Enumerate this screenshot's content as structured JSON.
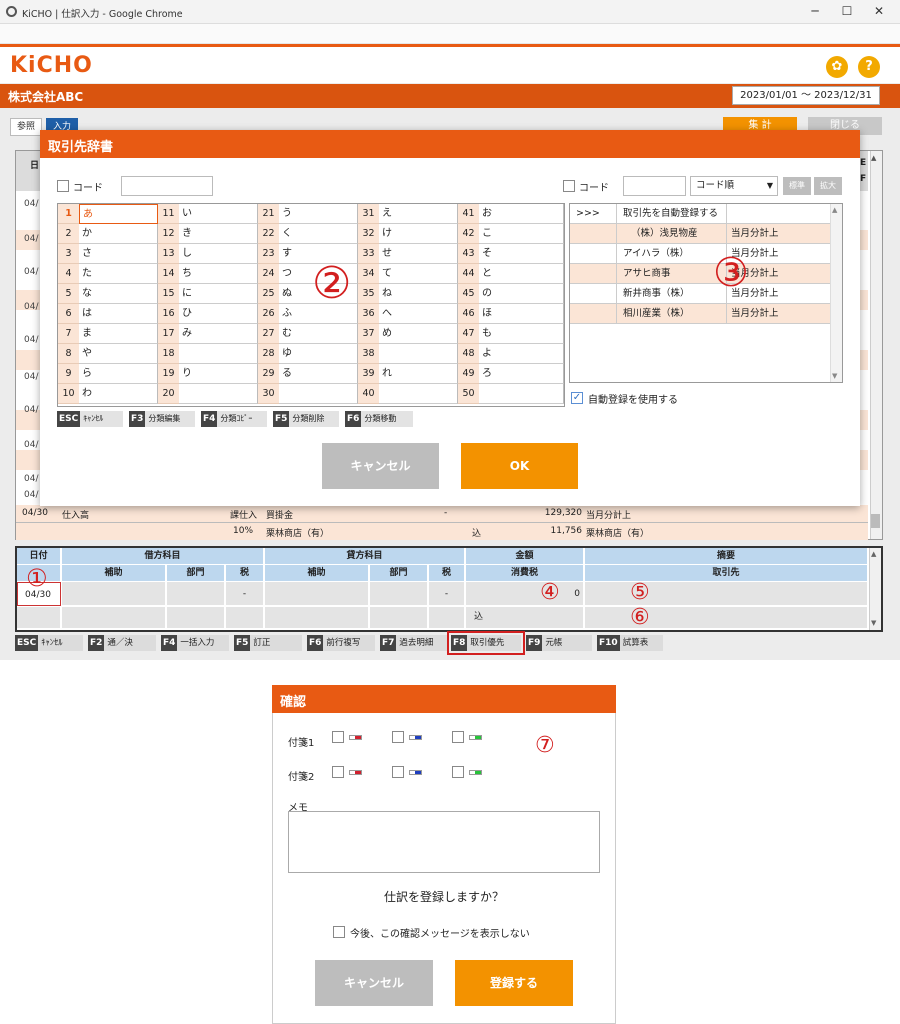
{
  "window": {
    "title": "KiCHO | 仕訳入力 - Google Chrome",
    "icon": "chrome-icon"
  },
  "app": {
    "logo": "KiCHO",
    "company": "株式会社ABC",
    "period": "2023/01/01 ～ 2023/12/31",
    "tabs": [
      "参照",
      "入力"
    ],
    "buttons": {
      "aggregate": "集 計",
      "close": "閉じる"
    },
    "icons": [
      "gear-icon",
      "help-icon"
    ]
  },
  "background_rows": [
    {
      "date": "04/"
    },
    {
      "date": "04/"
    },
    {
      "date": "04/"
    },
    {
      "date": "04/"
    },
    {
      "date": "04/"
    },
    {
      "date": "04/"
    },
    {
      "date": "04/"
    },
    {
      "date": "04/"
    },
    {
      "date": "04/"
    },
    {
      "date": "04/"
    }
  ],
  "grid_header": {
    "col1": "日",
    "col_e": "E",
    "col_f": "F"
  },
  "visible_entry": {
    "date": "04/30",
    "debit": "仕入高",
    "tax_cat": "課仕入",
    "credit": "買掛金",
    "dash": "-",
    "amount": "129,320",
    "summary": "当月分計上",
    "rate": "10%",
    "debit_partner": "栗林商店（有）",
    "incl": "込",
    "tax": "11,756",
    "partner": "栗林商店（有）"
  },
  "dialog": {
    "title": "取引先辞書",
    "code_label_left": "コード",
    "code_label_right": "コード",
    "sort_select": "コード順",
    "btn_standard": "標準",
    "btn_expand": "拡大",
    "kana_columns": [
      [
        [
          "1",
          "あ"
        ],
        [
          "2",
          "か"
        ],
        [
          "3",
          "さ"
        ],
        [
          "4",
          "た"
        ],
        [
          "5",
          "な"
        ],
        [
          "6",
          "は"
        ],
        [
          "7",
          "ま"
        ],
        [
          "8",
          "や"
        ],
        [
          "9",
          "ら"
        ],
        [
          "10",
          "わ"
        ]
      ],
      [
        [
          "11",
          "い"
        ],
        [
          "12",
          "き"
        ],
        [
          "13",
          "し"
        ],
        [
          "14",
          "ち"
        ],
        [
          "15",
          "に"
        ],
        [
          "16",
          "ひ"
        ],
        [
          "17",
          "み"
        ],
        [
          "18",
          ""
        ],
        [
          "19",
          "り"
        ],
        [
          "20",
          ""
        ]
      ],
      [
        [
          "21",
          "う"
        ],
        [
          "22",
          "く"
        ],
        [
          "23",
          "す"
        ],
        [
          "24",
          "つ"
        ],
        [
          "25",
          "ぬ"
        ],
        [
          "26",
          "ふ"
        ],
        [
          "27",
          "む"
        ],
        [
          "28",
          "ゆ"
        ],
        [
          "29",
          "る"
        ],
        [
          "30",
          ""
        ]
      ],
      [
        [
          "31",
          "え"
        ],
        [
          "32",
          "け"
        ],
        [
          "33",
          "せ"
        ],
        [
          "34",
          "て"
        ],
        [
          "35",
          "ね"
        ],
        [
          "36",
          "へ"
        ],
        [
          "37",
          "め"
        ],
        [
          "38",
          ""
        ],
        [
          "39",
          "れ"
        ],
        [
          "40",
          ""
        ]
      ],
      [
        [
          "41",
          "お"
        ],
        [
          "42",
          "こ"
        ],
        [
          "43",
          "そ"
        ],
        [
          "44",
          "と"
        ],
        [
          "45",
          "の"
        ],
        [
          "46",
          "ほ"
        ],
        [
          "47",
          "も"
        ],
        [
          "48",
          "よ"
        ],
        [
          "49",
          "ろ"
        ],
        [
          "50",
          ""
        ]
      ]
    ],
    "fkeys": [
      {
        "key": "ESC",
        "label": "ｷｬﾝｾﾙ"
      },
      {
        "key": "F3",
        "label": "分類編集"
      },
      {
        "key": "F4",
        "label": "分類ｺﾋﾟｰ"
      },
      {
        "key": "F5",
        "label": "分類削除"
      },
      {
        "key": "F6",
        "label": "分類移動"
      }
    ],
    "partners": [
      {
        "mark": ">>>",
        "name": "取引先を自動登録する",
        "note": ""
      },
      {
        "mark": "",
        "name": "（株）浅見物産",
        "note": "当月分計上"
      },
      {
        "mark": "",
        "name": "アイハラ（株）",
        "note": "当月分計上"
      },
      {
        "mark": "",
        "name": "アサヒ商事",
        "note": "当月分計上"
      },
      {
        "mark": "",
        "name": "新井商事（株）",
        "note": "当月分計上"
      },
      {
        "mark": "",
        "name": "相川産業（株）",
        "note": "当月分計上"
      }
    ],
    "auto_register": "自動登録を使用する",
    "cancel": "キャンセル",
    "ok": "OK"
  },
  "markers": {
    "m1": "①",
    "m2": "②",
    "m3": "③",
    "m4": "④",
    "m5": "⑤",
    "m6": "⑥",
    "m7": "⑦"
  },
  "entry_table": {
    "headers": {
      "date": "日付",
      "debit": "借方科目",
      "credit": "貸方科目",
      "amount": "金額",
      "summary": "摘要",
      "sub": "補助",
      "dept": "部門",
      "tax": "税",
      "sub2": "補助",
      "dept2": "部門",
      "tax2": "税",
      "ctax": "消費税",
      "partner": "取引先"
    },
    "row": {
      "date": "04/30",
      "dash1": "-",
      "dash2": "-",
      "tax_value": "0",
      "incl": "込"
    }
  },
  "bottom_fkeys": [
    {
      "key": "ESC",
      "label": "ｷｬﾝｾﾙ"
    },
    {
      "key": "F2",
      "label": "通／決"
    },
    {
      "key": "F4",
      "label": "一括入力"
    },
    {
      "key": "F5",
      "label": "訂正"
    },
    {
      "key": "F6",
      "label": "前行複写"
    },
    {
      "key": "F7",
      "label": "過去明細"
    },
    {
      "key": "F8",
      "label": "取引優先"
    },
    {
      "key": "F9",
      "label": "元帳"
    },
    {
      "key": "F10",
      "label": "試算表"
    }
  ],
  "confirm": {
    "title": "確認",
    "tag1": "付箋1",
    "tag2": "付箋2",
    "tag_colors": [
      "#d0202e",
      "#1f3fbf",
      "#27c23a"
    ],
    "memo_label": "メモ",
    "question": "仕訳を登録しますか？",
    "dont_show": "今後、この確認メッセージを表示しない",
    "cancel": "キャンセル",
    "register": "登録する"
  }
}
